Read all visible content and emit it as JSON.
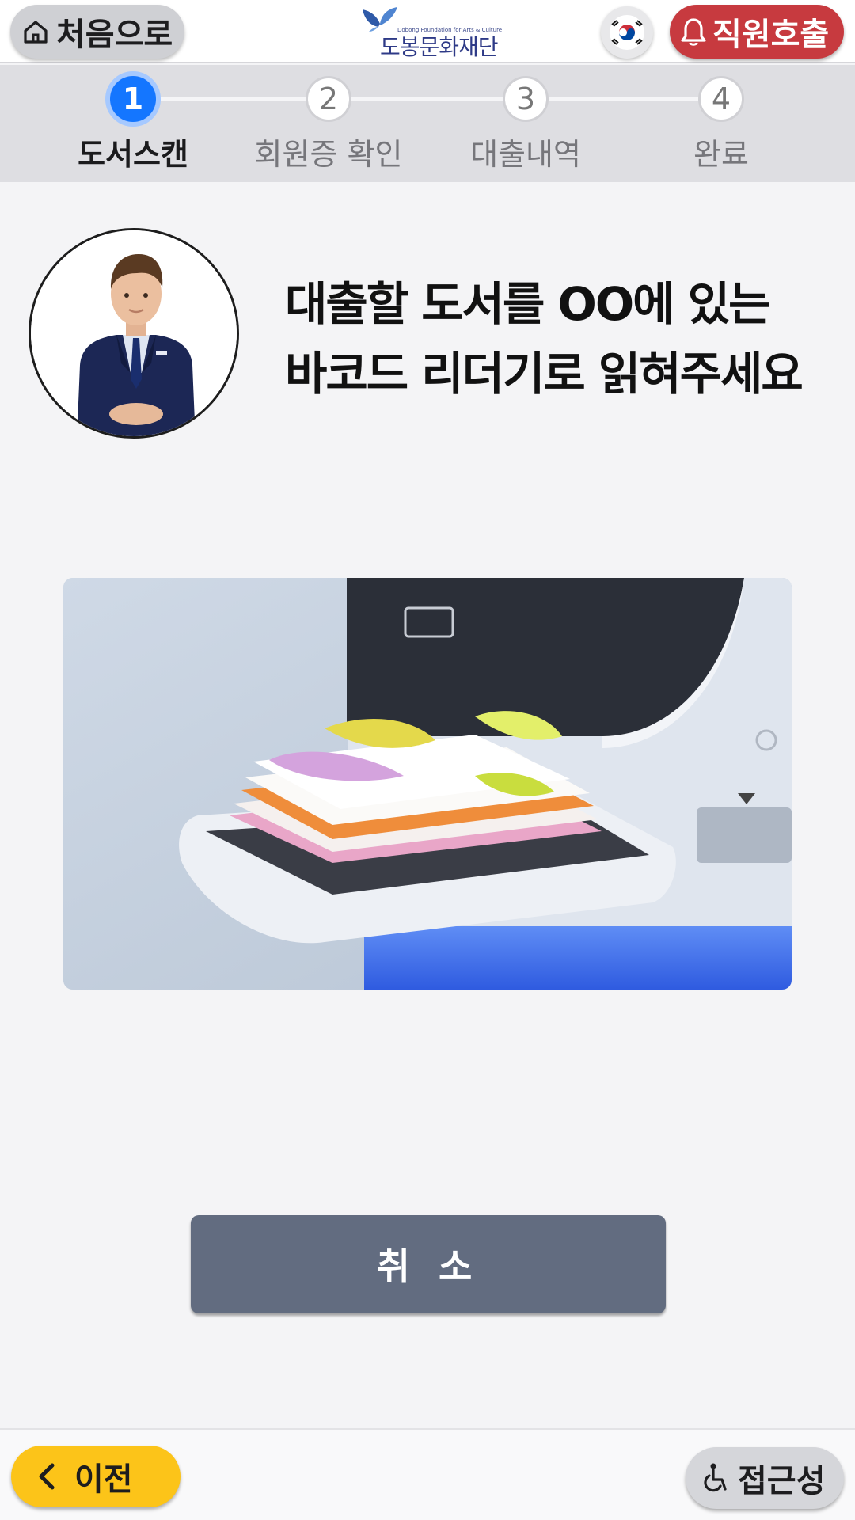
{
  "header": {
    "home_label": "처음으로",
    "logo_small": "Dobong Foundation for Arts & Culture",
    "logo_text": "도봉문화재단",
    "call_label": "직원호출"
  },
  "stepper": {
    "current_step": 1,
    "steps": [
      {
        "number": "1",
        "label": "도서스캔"
      },
      {
        "number": "2",
        "label": "회원증 확인"
      },
      {
        "number": "3",
        "label": "대출내역"
      },
      {
        "number": "4",
        "label": "완료"
      }
    ]
  },
  "instruction": {
    "line1": "대출할 도서를 OO에 있는",
    "line2": "바코드 리더기로 읽혀주세요"
  },
  "actions": {
    "cancel_label": "취 소"
  },
  "footer": {
    "prev_label": "이전",
    "access_label": "접근성"
  },
  "colors": {
    "accent": "#1476ff",
    "call": "#c73a3f",
    "prev": "#fcc419",
    "cancel": "#626c80"
  },
  "icons": [
    "home-icon",
    "korea-flag-icon",
    "bell-icon",
    "chevron-left-icon",
    "wheelchair-icon"
  ]
}
